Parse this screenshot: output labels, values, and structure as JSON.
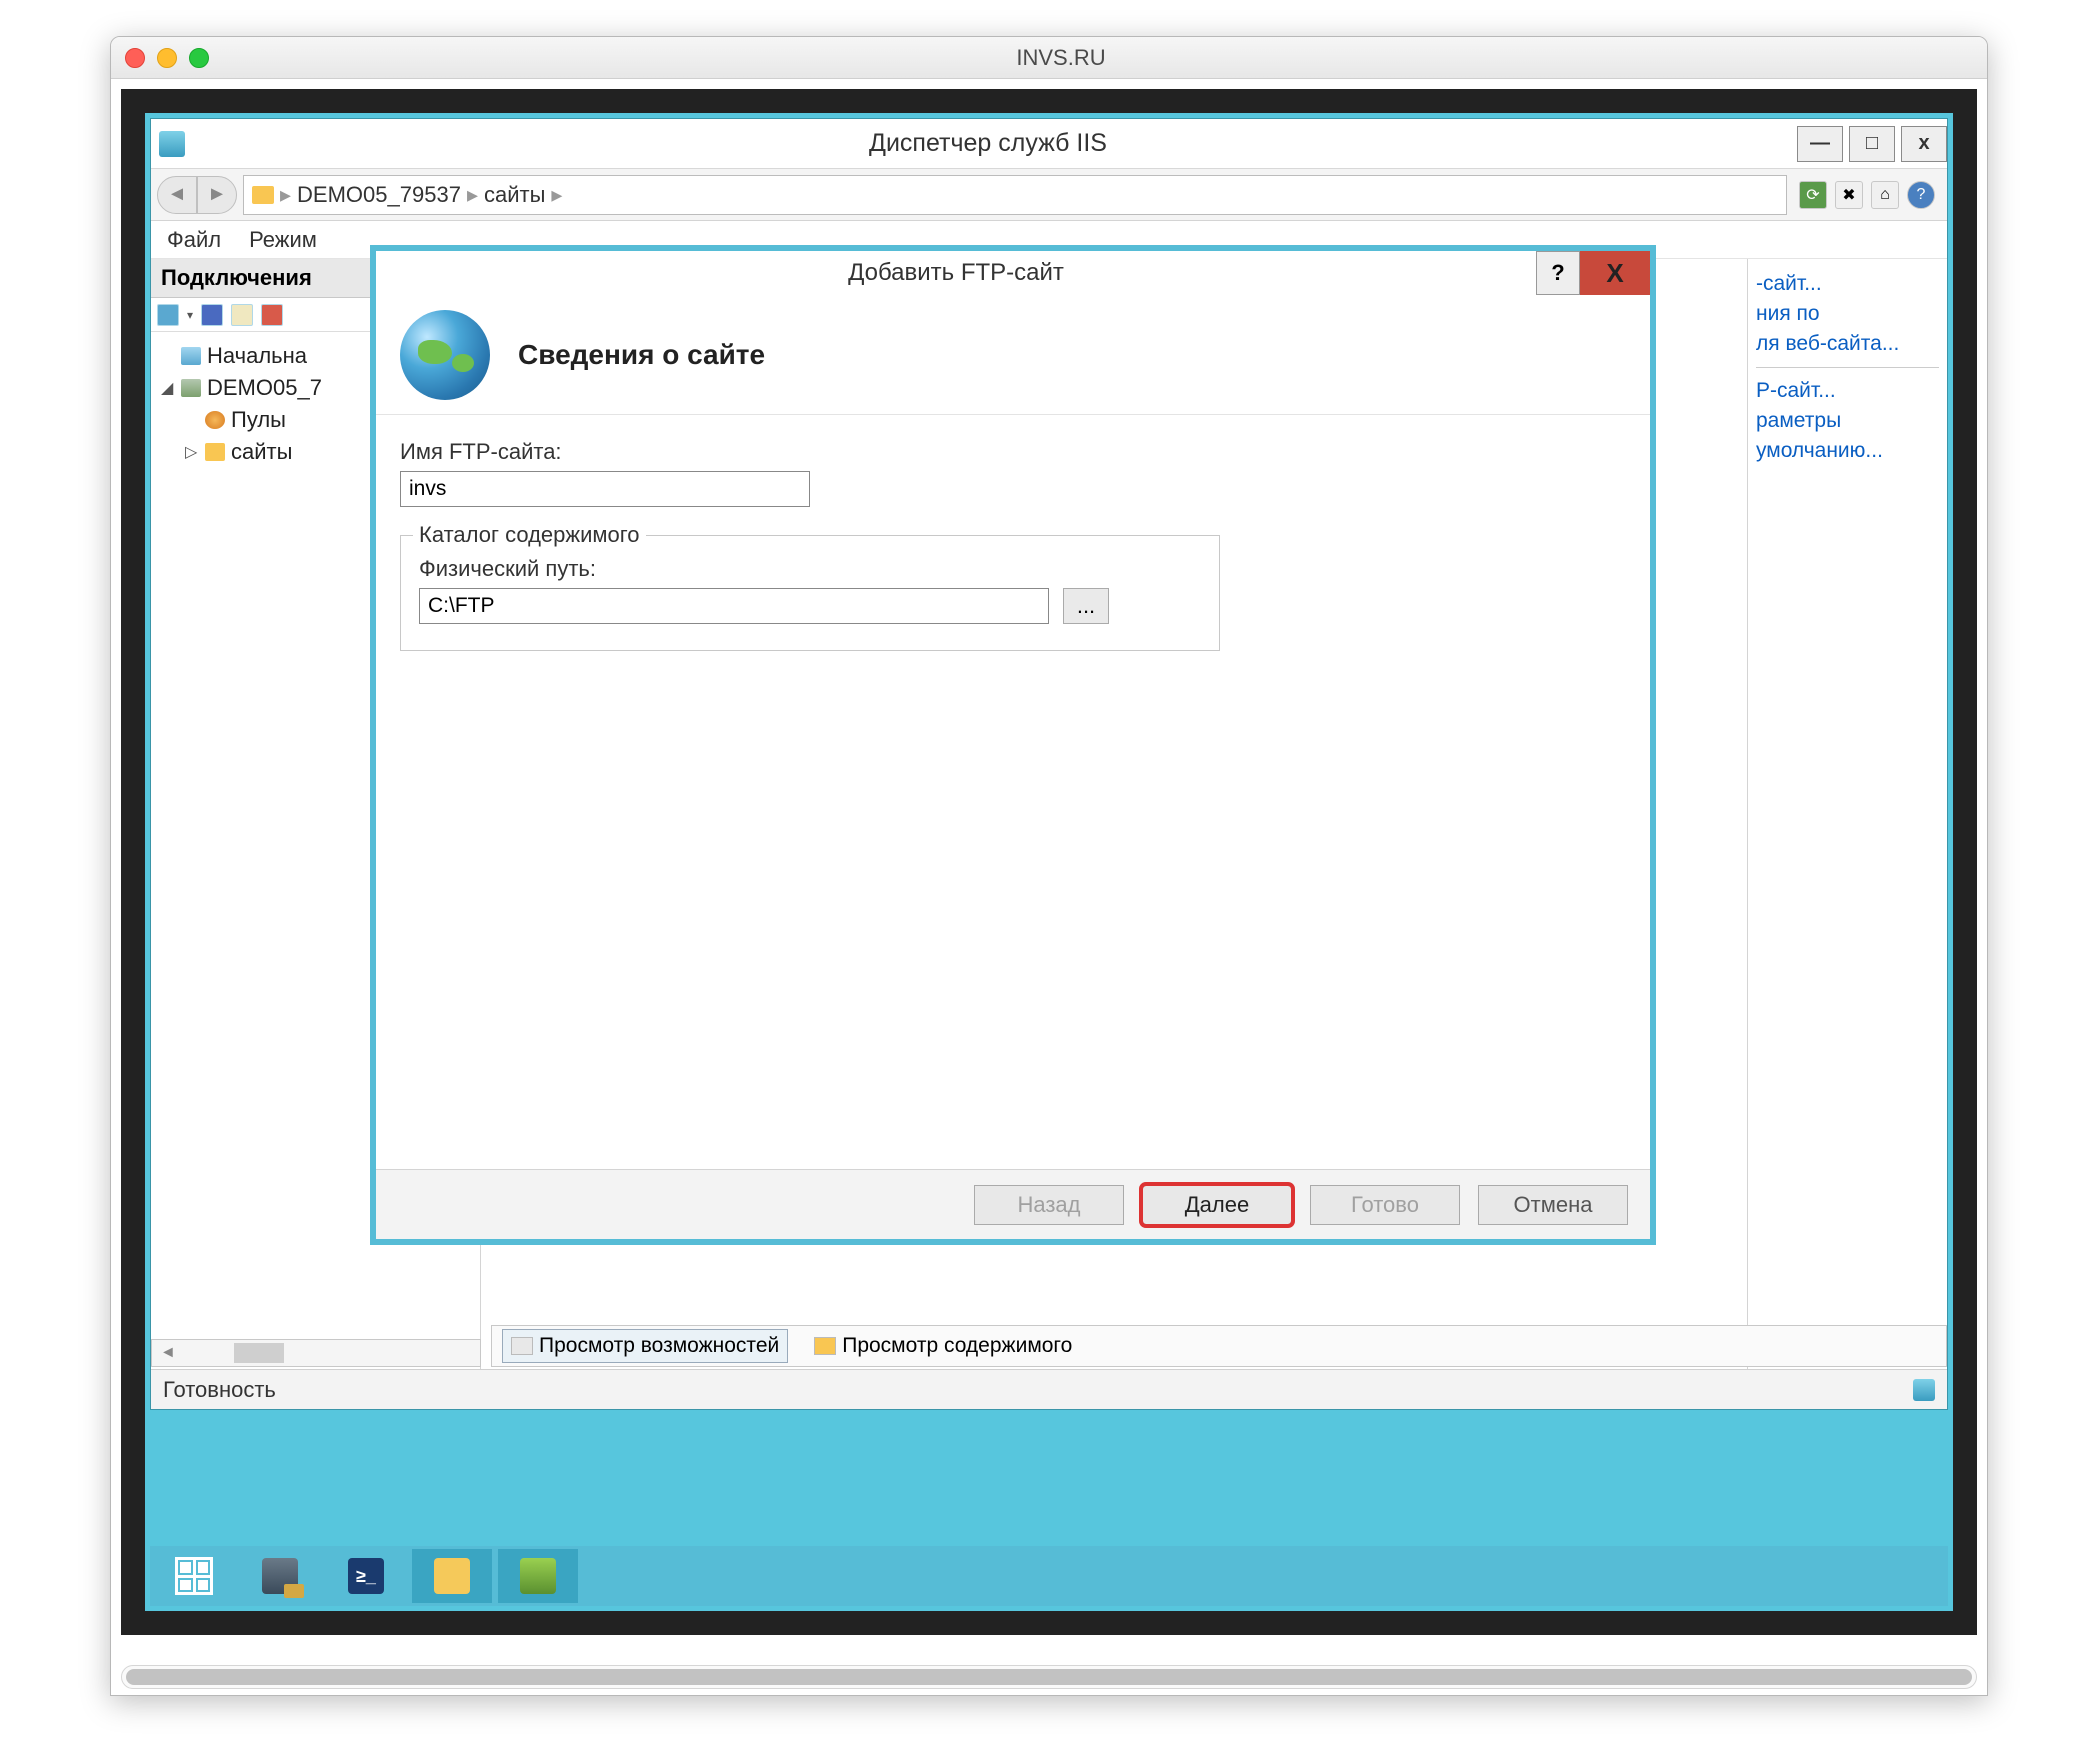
{
  "mac": {
    "title": "INVS.RU"
  },
  "iis": {
    "title": "Диспетчер служб IIS",
    "win_controls": {
      "min": "—",
      "max": "□",
      "close": "x"
    },
    "breadcrumb": {
      "seg1": "DEMO05_79537",
      "seg2": "сайты",
      "sep": "▸"
    },
    "menu": {
      "file": "Файл",
      "mode": "Режим"
    },
    "connections_header": "Подключения",
    "tree": {
      "start": "Начальна",
      "server": "DEMO05_7",
      "pools": "Пулы",
      "sites": "сайты"
    },
    "actions": {
      "link1": "-сайт...",
      "link2": "ния по",
      "link3": "ля веб-сайта...",
      "link4": "P-сайт...",
      "link5": "раметры",
      "link6": "умолчанию..."
    },
    "bottom_tabs": {
      "features": "Просмотр возможностей",
      "content": "Просмотр содержимого"
    },
    "status": "Готовность"
  },
  "wizard": {
    "title": "Добавить FTP-сайт",
    "help": "?",
    "close": "X",
    "heading": "Сведения о сайте",
    "site_name_label": "Имя FTP-сайта:",
    "site_name_value": "invs",
    "content_dir_legend": "Каталог содержимого",
    "path_label": "Физический путь:",
    "path_value": "C:\\FTP",
    "browse": "...",
    "buttons": {
      "back": "Назад",
      "next": "Далее",
      "finish": "Готово",
      "cancel": "Отмена"
    }
  }
}
